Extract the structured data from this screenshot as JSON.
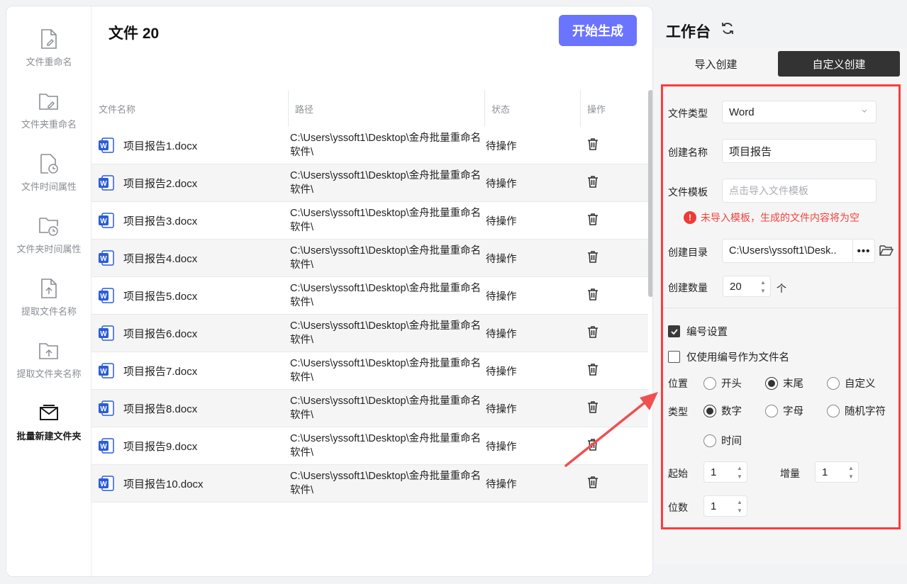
{
  "sidebar": {
    "items": [
      {
        "label": "文件重命名",
        "icon": "file-edit-icon"
      },
      {
        "label": "文件夹重命名",
        "icon": "folder-edit-icon"
      },
      {
        "label": "文件时间属性",
        "icon": "file-clock-icon"
      },
      {
        "label": "文件夹时间属性",
        "icon": "folder-clock-icon"
      },
      {
        "label": "提取文件名称",
        "icon": "file-upload-icon"
      },
      {
        "label": "提取文件夹名称",
        "icon": "folder-upload-icon"
      },
      {
        "label": "批量新建文件夹",
        "icon": "mail-folder-icon",
        "active": true
      }
    ]
  },
  "main": {
    "title": "文件 20",
    "start_button": "开始生成",
    "columns": [
      "文件名称",
      "路径",
      "状态",
      "操作"
    ],
    "rows": [
      {
        "name": "项目报告1.docx",
        "path": "C:\\Users\\yssoft1\\Desktop\\金舟批量重命名软件\\",
        "status": "待操作"
      },
      {
        "name": "项目报告2.docx",
        "path": "C:\\Users\\yssoft1\\Desktop\\金舟批量重命名软件\\",
        "status": "待操作"
      },
      {
        "name": "项目报告3.docx",
        "path": "C:\\Users\\yssoft1\\Desktop\\金舟批量重命名软件\\",
        "status": "待操作"
      },
      {
        "name": "项目报告4.docx",
        "path": "C:\\Users\\yssoft1\\Desktop\\金舟批量重命名软件\\",
        "status": "待操作"
      },
      {
        "name": "项目报告5.docx",
        "path": "C:\\Users\\yssoft1\\Desktop\\金舟批量重命名软件\\",
        "status": "待操作"
      },
      {
        "name": "项目报告6.docx",
        "path": "C:\\Users\\yssoft1\\Desktop\\金舟批量重命名软件\\",
        "status": "待操作"
      },
      {
        "name": "项目报告7.docx",
        "path": "C:\\Users\\yssoft1\\Desktop\\金舟批量重命名软件\\",
        "status": "待操作"
      },
      {
        "name": "项目报告8.docx",
        "path": "C:\\Users\\yssoft1\\Desktop\\金舟批量重命名软件\\",
        "status": "待操作"
      },
      {
        "name": "项目报告9.docx",
        "path": "C:\\Users\\yssoft1\\Desktop\\金舟批量重命名软件\\",
        "status": "待操作"
      },
      {
        "name": "项目报告10.docx",
        "path": "C:\\Users\\yssoft1\\Desktop\\金舟批量重命名软件\\",
        "status": "待操作"
      }
    ]
  },
  "workbench": {
    "title": "工作台",
    "tabs": {
      "import": "导入创建",
      "custom": "自定义创建"
    },
    "file_type": {
      "label": "文件类型",
      "value": "Word"
    },
    "create_name": {
      "label": "创建名称",
      "value": "项目报告"
    },
    "template": {
      "label": "文件模板",
      "placeholder": "点击导入文件模板"
    },
    "warning": "未导入模板，生成的文件内容将为空",
    "directory": {
      "label": "创建目录",
      "value": "C:\\Users\\yssoft1\\Desk.."
    },
    "count": {
      "label": "创建数量",
      "value": "20",
      "unit": "个"
    },
    "numbering": {
      "label": "编号设置",
      "checked": true
    },
    "only_number": {
      "label": "仅使用编号作为文件名",
      "checked": false
    },
    "position": {
      "label": "位置",
      "options": [
        "开头",
        "末尾",
        "自定义"
      ],
      "selected": "末尾"
    },
    "type": {
      "label": "类型",
      "options": [
        "数字",
        "字母",
        "随机字符",
        "时间"
      ],
      "selected": "数字"
    },
    "start": {
      "label": "起始",
      "value": "1"
    },
    "increment": {
      "label": "增量",
      "value": "1"
    },
    "digits": {
      "label": "位数",
      "value": "1"
    }
  },
  "colors": {
    "accent": "#6b74ff",
    "highlight": "#ff3b3b",
    "word_blue": "#2b5dd6"
  }
}
